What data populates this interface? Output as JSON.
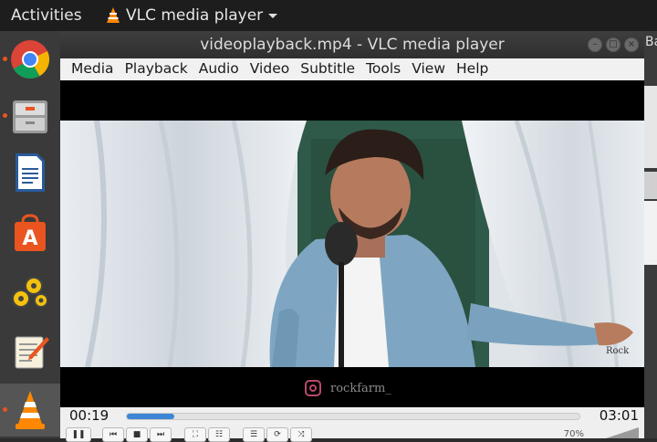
{
  "topbar": {
    "activities": "Activities",
    "app_name": "VLC media player"
  },
  "dock": {
    "items": [
      "chrome-icon",
      "files-icon",
      "writer-icon",
      "software-center-icon",
      "settings-gears-icon",
      "text-editor-icon",
      "vlc-icon"
    ]
  },
  "background_window": {
    "text": "Ba"
  },
  "window": {
    "title": "videoplayback.mp4 - VLC media player"
  },
  "menu": {
    "media": "Media",
    "playback": "Playback",
    "audio": "Audio",
    "video": "Video",
    "subtitle": "Subtitle",
    "tools": "Tools",
    "view": "View",
    "help": "Help"
  },
  "video": {
    "logo_text": "Rock",
    "watermark": "rockfarm_"
  },
  "controls": {
    "time_current": "00:19",
    "time_total": "03:01",
    "progress": 0.105,
    "volume": "70%"
  }
}
